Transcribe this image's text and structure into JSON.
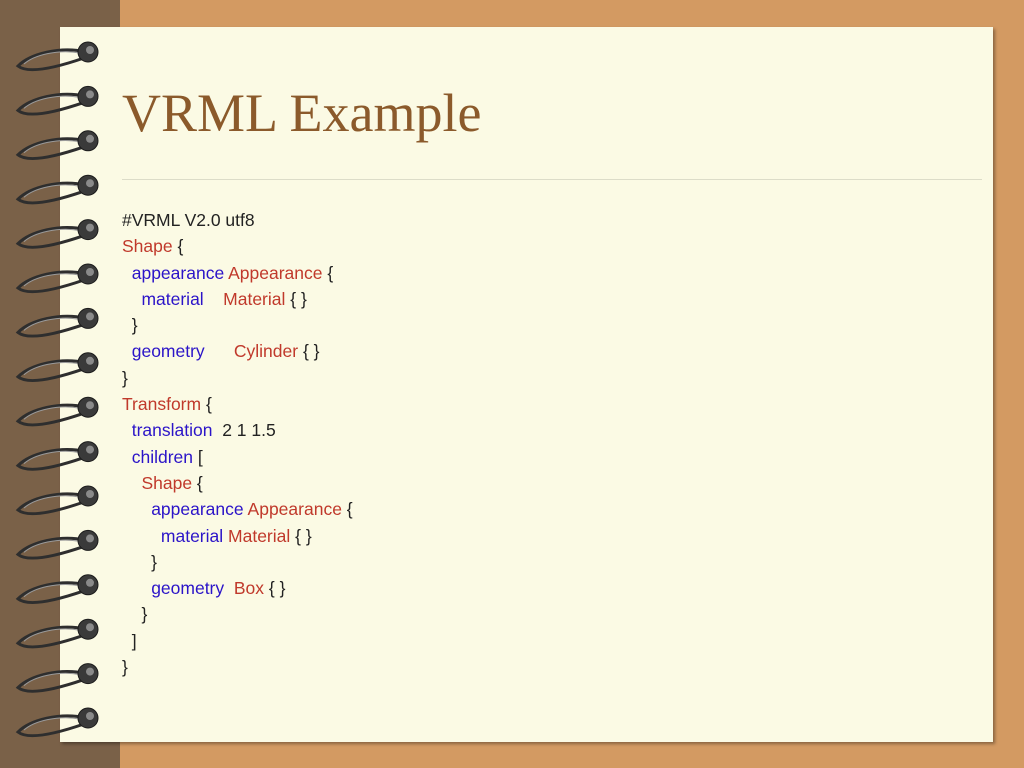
{
  "slide": {
    "title": "VRML Example",
    "code_lines": [
      [
        {
          "text": "#VRML V2.0 utf8",
          "style": "p"
        }
      ],
      [
        {
          "text": "Shape",
          "style": "t"
        },
        {
          "text": " {",
          "style": "p"
        }
      ],
      [
        {
          "text": "  ",
          "style": "p"
        },
        {
          "text": "appearance",
          "style": "k"
        },
        {
          "text": " ",
          "style": "p"
        },
        {
          "text": "Appearance",
          "style": "t"
        },
        {
          "text": " {",
          "style": "p"
        }
      ],
      [
        {
          "text": "    ",
          "style": "p"
        },
        {
          "text": "material",
          "style": "k"
        },
        {
          "text": "    ",
          "style": "p"
        },
        {
          "text": "Material",
          "style": "t"
        },
        {
          "text": " { }",
          "style": "p"
        }
      ],
      [
        {
          "text": "  }",
          "style": "p"
        }
      ],
      [
        {
          "text": "  ",
          "style": "p"
        },
        {
          "text": "geometry",
          "style": "k"
        },
        {
          "text": "      ",
          "style": "p"
        },
        {
          "text": "Cylinder",
          "style": "t"
        },
        {
          "text": " { }",
          "style": "p"
        }
      ],
      [
        {
          "text": "}",
          "style": "p"
        }
      ],
      [
        {
          "text": "Transform",
          "style": "t"
        },
        {
          "text": " {",
          "style": "p"
        }
      ],
      [
        {
          "text": "  ",
          "style": "p"
        },
        {
          "text": "translation",
          "style": "k"
        },
        {
          "text": "  2 1 1.5",
          "style": "p"
        }
      ],
      [
        {
          "text": "  ",
          "style": "p"
        },
        {
          "text": "children",
          "style": "k"
        },
        {
          "text": " [",
          "style": "p"
        }
      ],
      [
        {
          "text": "    ",
          "style": "p"
        },
        {
          "text": "Shape",
          "style": "t"
        },
        {
          "text": " {",
          "style": "p"
        }
      ],
      [
        {
          "text": "      ",
          "style": "p"
        },
        {
          "text": "appearance",
          "style": "k"
        },
        {
          "text": " ",
          "style": "p"
        },
        {
          "text": "Appearance",
          "style": "t"
        },
        {
          "text": " {",
          "style": "p"
        }
      ],
      [
        {
          "text": "        ",
          "style": "p"
        },
        {
          "text": "material",
          "style": "k"
        },
        {
          "text": " ",
          "style": "p"
        },
        {
          "text": "Material",
          "style": "t"
        },
        {
          "text": " { }",
          "style": "p"
        }
      ],
      [
        {
          "text": "      }",
          "style": "p"
        }
      ],
      [
        {
          "text": "      ",
          "style": "p"
        },
        {
          "text": "geometry",
          "style": "k"
        },
        {
          "text": "  ",
          "style": "p"
        },
        {
          "text": "Box",
          "style": "t"
        },
        {
          "text": " { }",
          "style": "p"
        }
      ],
      [
        {
          "text": "    }",
          "style": "p"
        }
      ],
      [
        {
          "text": "  ]",
          "style": "p"
        }
      ],
      [
        {
          "text": "}",
          "style": "p"
        }
      ]
    ]
  },
  "colors": {
    "background": "#d39a62",
    "spine": "#7a6148",
    "paper": "#fbfae4",
    "title": "#8b5a2b",
    "keyword": "#2b14c8",
    "type": "#c0392b",
    "plain": "#222222"
  },
  "icons": {
    "binding": "spiral-ring-icon"
  }
}
